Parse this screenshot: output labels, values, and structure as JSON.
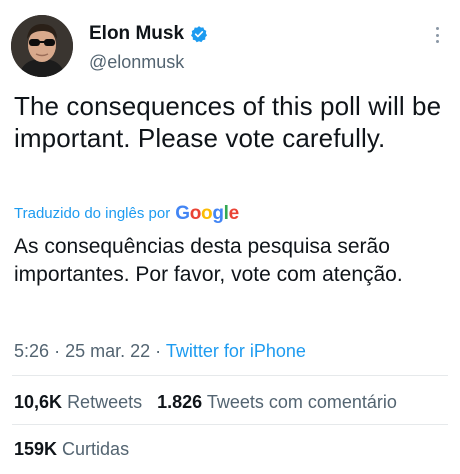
{
  "author": {
    "name": "Elon Musk",
    "handle": "@elonmusk",
    "verified": true
  },
  "tweet": {
    "text": "The consequences of this poll will be important. Please vote carefully.",
    "translated_label": "Traduzido do inglês por",
    "translator_logo": "Google",
    "translation": "As consequências desta pesquisa serão importantes. Por favor, vote com atenção."
  },
  "meta": {
    "time": "5:26",
    "date": "25 mar. 22",
    "source": "Twitter for iPhone",
    "separator": "·"
  },
  "stats": {
    "retweets_count": "10,6K",
    "retweets_label": "Retweets",
    "quotes_count": "1.826",
    "quotes_label": "Tweets com comentário",
    "likes_count": "159K",
    "likes_label": "Curtidas"
  },
  "colors": {
    "accent": "#1d9bf0",
    "secondary_text": "#536471",
    "primary_text": "#0f1419"
  },
  "icons": {
    "verified": "verified-badge-icon",
    "more": "more-options-icon"
  }
}
